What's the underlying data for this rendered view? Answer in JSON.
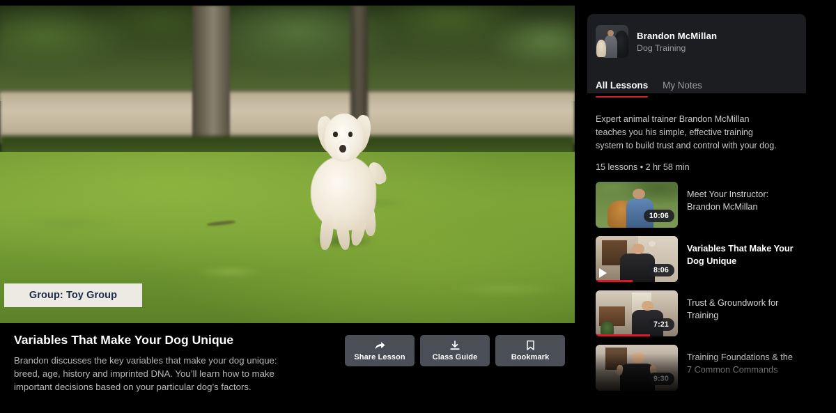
{
  "video": {
    "caption_overlay": "Group: Toy Group"
  },
  "lesson": {
    "title": "Variables That Make Your Dog Unique",
    "description": "Brandon discusses the key variables that make your dog unique: breed, age, history and imprinted DNA. You’ll learn how to make important decisions based on your particular dog’s factors."
  },
  "actions": [
    {
      "label": "Share Lesson",
      "icon": "share-icon"
    },
    {
      "label": "Class Guide",
      "icon": "download-icon"
    },
    {
      "label": "Bookmark",
      "icon": "bookmark-icon"
    }
  ],
  "sidebar": {
    "instructor": {
      "name": "Brandon McMillan",
      "subject": "Dog Training",
      "avatar_alt": "instructor-avatar"
    },
    "tabs": [
      {
        "label": "All Lessons",
        "active": true
      },
      {
        "label": "My Notes",
        "active": false
      }
    ],
    "course_description": "Expert animal trainer Brandon McMillan teaches you his simple, effective training system to build trust and control with your dog.",
    "course_meta": "15 lessons • 2 hr 58 min",
    "lessons": [
      {
        "title": "Meet Your Instructor: Brandon McMillan",
        "duration": "10:06",
        "progress": 0,
        "current": false,
        "playing": false
      },
      {
        "title": "Variables That Make Your Dog Unique",
        "duration": "8:06",
        "progress": 45,
        "current": true,
        "playing": true
      },
      {
        "title": "Trust & Groundwork for Training",
        "duration": "7:21",
        "progress": 66,
        "current": false,
        "playing": false
      },
      {
        "title": "Training Foundations & the 7 Common Commands",
        "duration": "9:30",
        "progress": 0,
        "current": false,
        "playing": false
      }
    ]
  },
  "colors": {
    "accent_red": "#d9232d",
    "progress_red": "#e0162b",
    "card_bg": "#1b1d20",
    "page_bg": "#000000",
    "button_bg": "#4a4f57",
    "caption_bg": "#eceae3",
    "caption_text": "#1b2a4a"
  }
}
